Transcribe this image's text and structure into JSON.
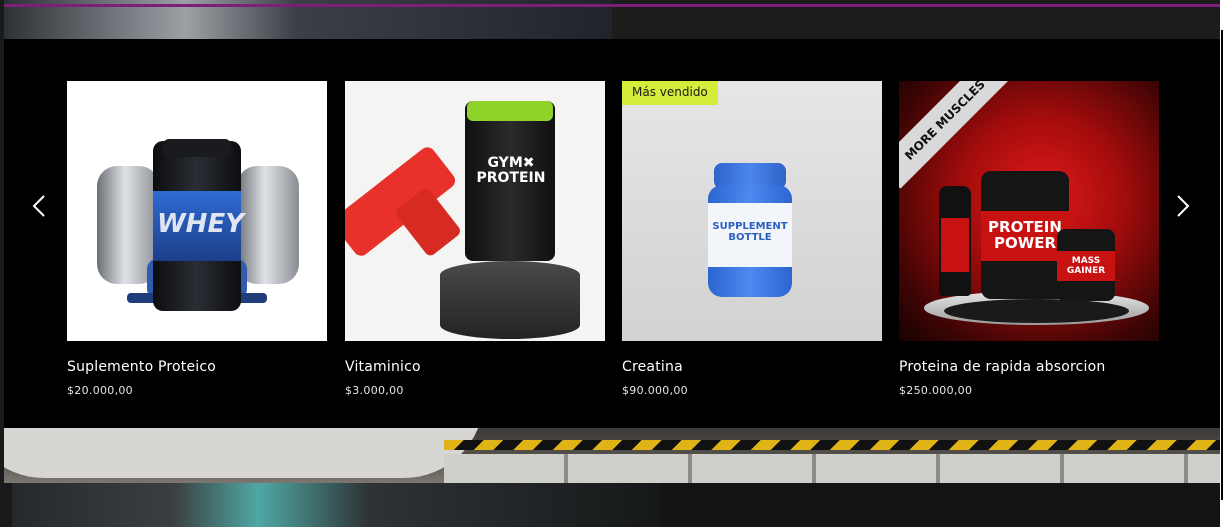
{
  "carousel": {
    "prev_icon": "chevron-left-icon",
    "next_icon": "chevron-right-icon",
    "products": [
      {
        "name": "Suplemento Proteico",
        "price": "$20.000,00",
        "badge": "",
        "image_text": "WHEY"
      },
      {
        "name": "Vitaminico",
        "price": "$3.000,00",
        "badge": "",
        "image_text": "GYM✖ PROTEIN"
      },
      {
        "name": "Creatina",
        "price": "$90.000,00",
        "badge": "Más vendido",
        "image_text": "SUPPLEMENT BOTTLE"
      },
      {
        "name": "Proteina de rapida absorcion",
        "price": "$250.000,00",
        "badge": "",
        "image_text": "PROTEIN POWER"
      }
    ],
    "product4_banner": "MORE MUSCLES",
    "product4_small_jar": "MASS GAINER"
  },
  "colors": {
    "accent": "#7b1f7a",
    "badge": "#d6ec3a",
    "carousel_bg": "#000000"
  }
}
